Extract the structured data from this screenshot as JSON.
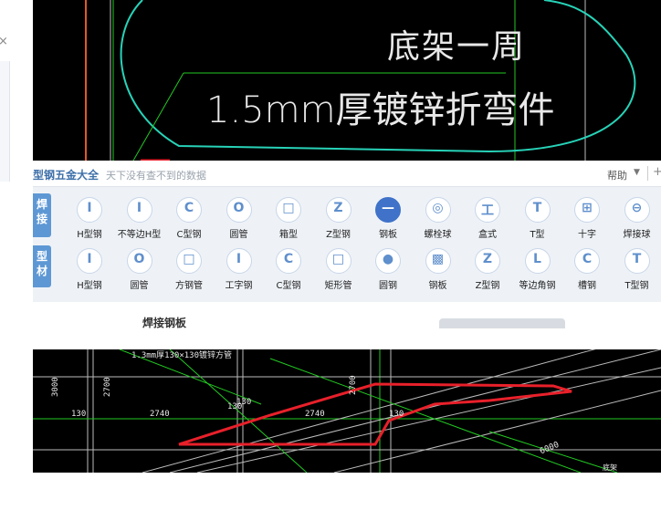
{
  "window": {
    "close_glyph": "×"
  },
  "cad_top": {
    "title": "底架一周",
    "subtitle": "1.5mm厚镀锌折弯件"
  },
  "toolbox": {
    "title": "型钢五金大全",
    "search_hint": "天下没有查不到的数据",
    "help_label": "帮助",
    "help_arrow": "▼",
    "plus_glyph": "+",
    "tabs": [
      {
        "label": "焊接"
      },
      {
        "label": "型材"
      }
    ],
    "row_weld": [
      {
        "label": "H型钢",
        "icon": "I"
      },
      {
        "label": "不等边H型",
        "icon": "I"
      },
      {
        "label": "C型钢",
        "icon": "C"
      },
      {
        "label": "圆管",
        "icon": "O"
      },
      {
        "label": "箱型",
        "icon": "□"
      },
      {
        "label": "Z型钢",
        "icon": "Z"
      },
      {
        "label": "钢板",
        "icon": "—"
      },
      {
        "label": "螺栓球",
        "icon": "◎"
      },
      {
        "label": "盒式",
        "icon": "工"
      },
      {
        "label": "T型",
        "icon": "T"
      },
      {
        "label": "十字",
        "icon": "⊞"
      },
      {
        "label": "焊接球",
        "icon": "⊖"
      }
    ],
    "row_profile": [
      {
        "label": "H型钢",
        "icon": "I"
      },
      {
        "label": "圆管",
        "icon": "O"
      },
      {
        "label": "方钢管",
        "icon": "□"
      },
      {
        "label": "工字钢",
        "icon": "I"
      },
      {
        "label": "C型钢",
        "icon": "C"
      },
      {
        "label": "矩形管",
        "icon": "□"
      },
      {
        "label": "圆钢",
        "icon": "●"
      },
      {
        "label": "钢板",
        "icon": "▩"
      },
      {
        "label": "Z型钢",
        "icon": "Z"
      },
      {
        "label": "等边角钢",
        "icon": "L"
      },
      {
        "label": "槽钢",
        "icon": "C"
      },
      {
        "label": "T型钢",
        "icon": "T"
      }
    ],
    "active_tool": "钢板",
    "properties_label": "焊接钢板"
  },
  "cad_bottom": {
    "annotation": "1.3mm厚130×130镀锌方管",
    "dims": {
      "d3000": "3000",
      "d2700_left": "2700",
      "d130_left": "130",
      "d2740_left": "2740",
      "d130_mid": "130",
      "d130_mid2": "130",
      "d2740_mid": "2740",
      "d2700_mid": "2700",
      "d130_right": "130",
      "d6000": "6000",
      "label_base": "底架"
    }
  },
  "colors": {
    "cad_bg": "#000000",
    "cyan": "#27d3b8",
    "green": "#22c922",
    "red": "#e8202a",
    "accent": "#3f72c8"
  }
}
